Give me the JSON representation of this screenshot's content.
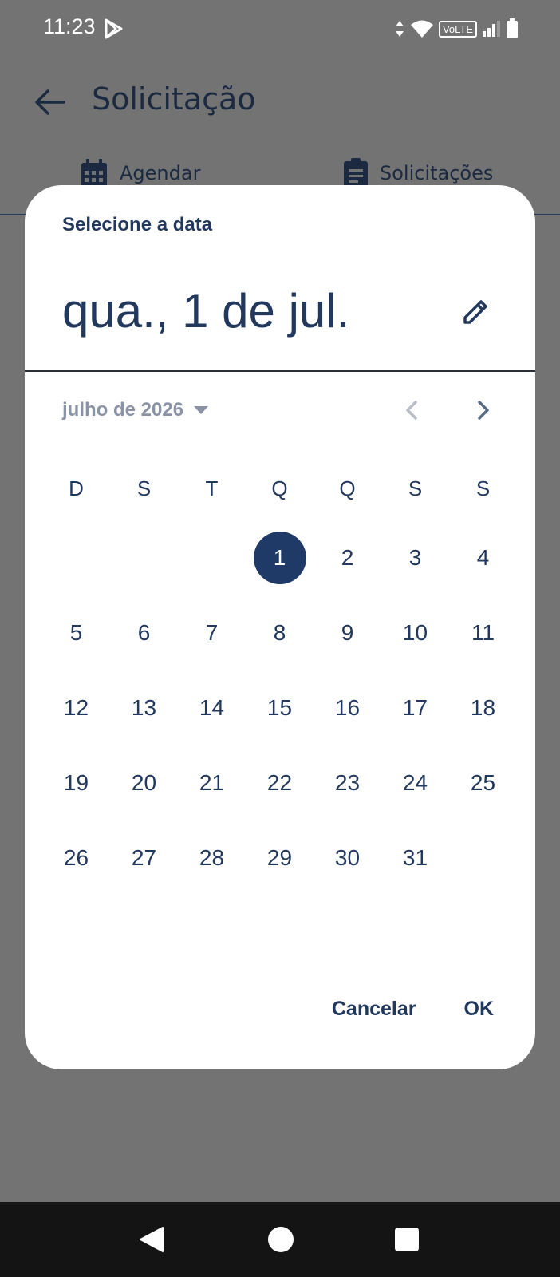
{
  "status_bar": {
    "time": "11:23",
    "network_badge": "VoLTE"
  },
  "app": {
    "title": "Solicitação",
    "tabs": [
      {
        "label": "Agendar",
        "icon": "calendar-icon"
      },
      {
        "label": "Solicitações",
        "icon": "clipboard-icon"
      }
    ]
  },
  "dialog": {
    "heading": "Selecione a data",
    "selected_date_label": "qua., 1 de jul.",
    "month_label": "julho de 2026",
    "weekdays": [
      "D",
      "S",
      "T",
      "Q",
      "Q",
      "S",
      "S"
    ],
    "selected_day": "1",
    "weeks": [
      [
        "",
        "",
        "",
        "1",
        "2",
        "3",
        "4"
      ],
      [
        "5",
        "6",
        "7",
        "8",
        "9",
        "10",
        "11"
      ],
      [
        "12",
        "13",
        "14",
        "15",
        "16",
        "17",
        "18"
      ],
      [
        "19",
        "20",
        "21",
        "22",
        "23",
        "24",
        "25"
      ],
      [
        "26",
        "27",
        "28",
        "29",
        "30",
        "31",
        ""
      ]
    ],
    "cancel_label": "Cancelar",
    "ok_label": "OK"
  },
  "colors": {
    "accent": "#1f3a66",
    "scrim": "#737373",
    "dialog_bg": "#ffffff",
    "muted": "#8a93a6"
  }
}
